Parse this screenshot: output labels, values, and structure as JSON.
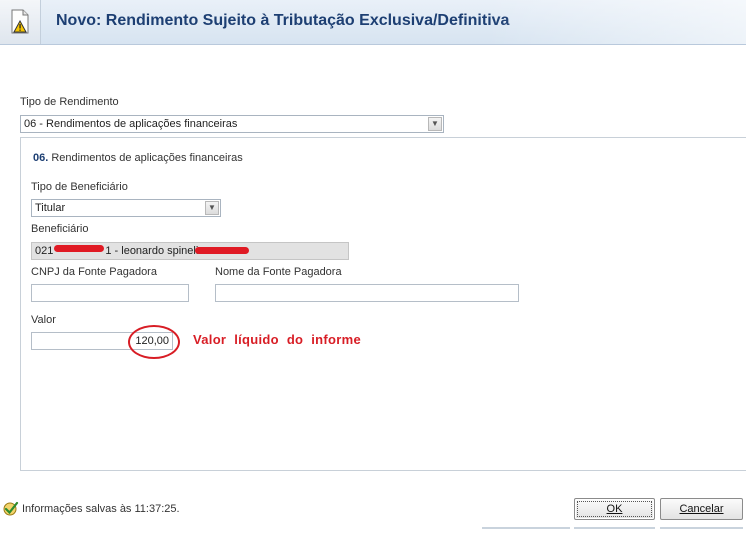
{
  "header": {
    "title": "Novo: Rendimento Sujeito à Tributação Exclusiva/Definitiva"
  },
  "form": {
    "tipo_rendimento_label": "Tipo de Rendimento",
    "tipo_rendimento_value": "06 - Rendimentos de aplicações financeiras",
    "section_number": "06.",
    "section_title": "Rendimentos de aplicações financeiras",
    "tipo_beneficiario_label": "Tipo de Beneficiário",
    "tipo_beneficiario_value": "Titular",
    "beneficiario_label": "Beneficiário",
    "beneficiario_prefix": "021",
    "beneficiario_mid": "1 - leonardo spineli",
    "cnpj_label": "CNPJ da Fonte Pagadora",
    "cnpj_value": "",
    "nome_fonte_label": "Nome da Fonte Pagadora",
    "nome_fonte_value": "",
    "valor_label": "Valor",
    "valor_value": "120,00",
    "annotation": "Valor líquido do informe"
  },
  "status": {
    "text": "Informações salvas às 11:37:25."
  },
  "buttons": {
    "ok_label": "OK",
    "cancel_label": "Cancelar"
  },
  "colors": {
    "title": "#1d3f73",
    "annotation": "#d81d25"
  }
}
